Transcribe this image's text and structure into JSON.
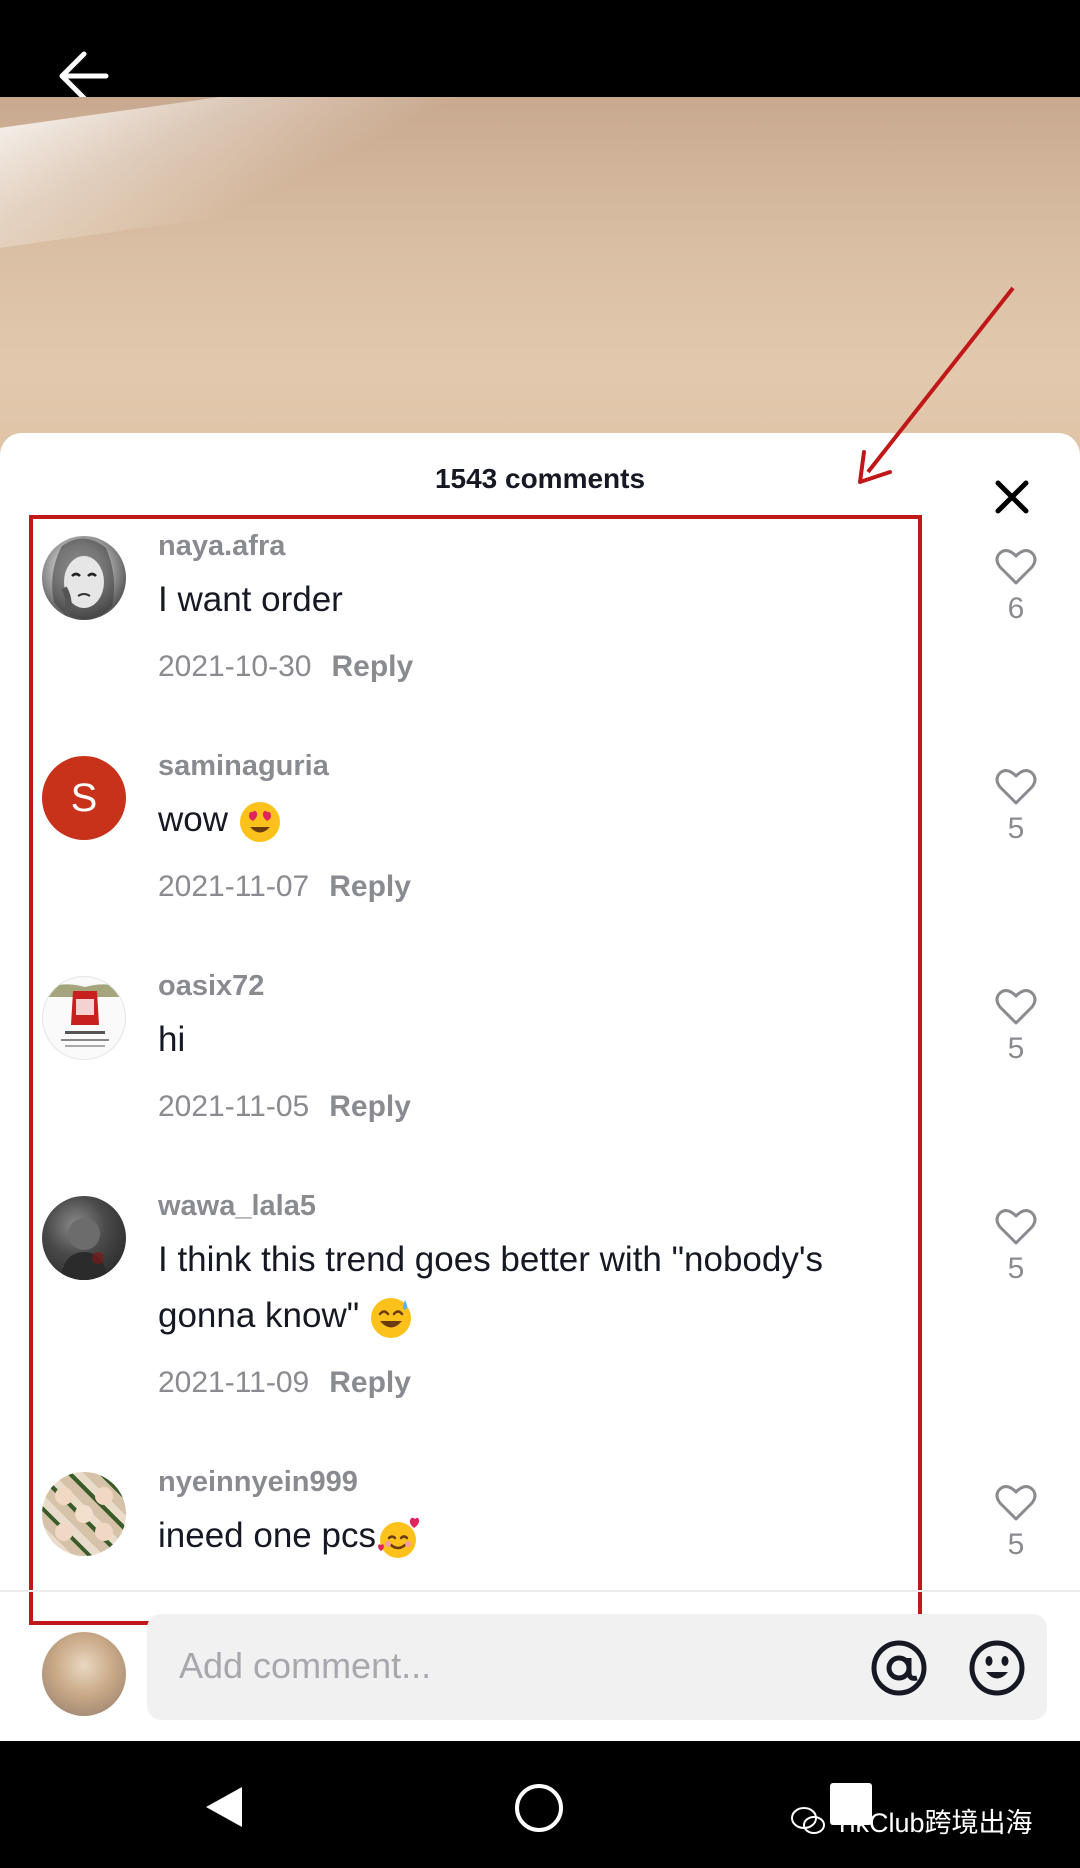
{
  "header": {
    "back_icon": "arrow-left-icon"
  },
  "comments_sheet": {
    "title": "1543 comments",
    "close_icon": "close-icon",
    "comments": [
      {
        "username": "naya.afra",
        "text": "I want order",
        "emoji": "",
        "date": "2021-10-30",
        "reply_label": "Reply",
        "likes": "6"
      },
      {
        "username": "saminaguria",
        "avatar_letter": "S",
        "text": "wow",
        "emoji": "heart-eyes-emoji",
        "date": "2021-11-07",
        "reply_label": "Reply",
        "likes": "5"
      },
      {
        "username": "oasix72",
        "text": "hi",
        "emoji": "",
        "date": "2021-11-05",
        "reply_label": "Reply",
        "likes": "5"
      },
      {
        "username": "wawa_lala5",
        "text": "I think this trend goes better with \"nobody's gonna know\"",
        "emoji": "sweat-smile-emoji",
        "date": "2021-11-09",
        "reply_label": "Reply",
        "likes": "5"
      },
      {
        "username": "nyeinnyein999",
        "text": "ineed one pcs",
        "emoji": "smiling-hearts-emoji",
        "likes": "5"
      }
    ]
  },
  "comment_input": {
    "placeholder": "Add comment...",
    "mention_icon": "at-sign-icon",
    "emoji_icon": "smiley-icon"
  },
  "system_nav": {
    "watermark": "TikClub跨境出海"
  },
  "colors": {
    "annotation": "#c01818",
    "avatar_s": "#c8321b",
    "muted_text": "#8a8b91"
  }
}
